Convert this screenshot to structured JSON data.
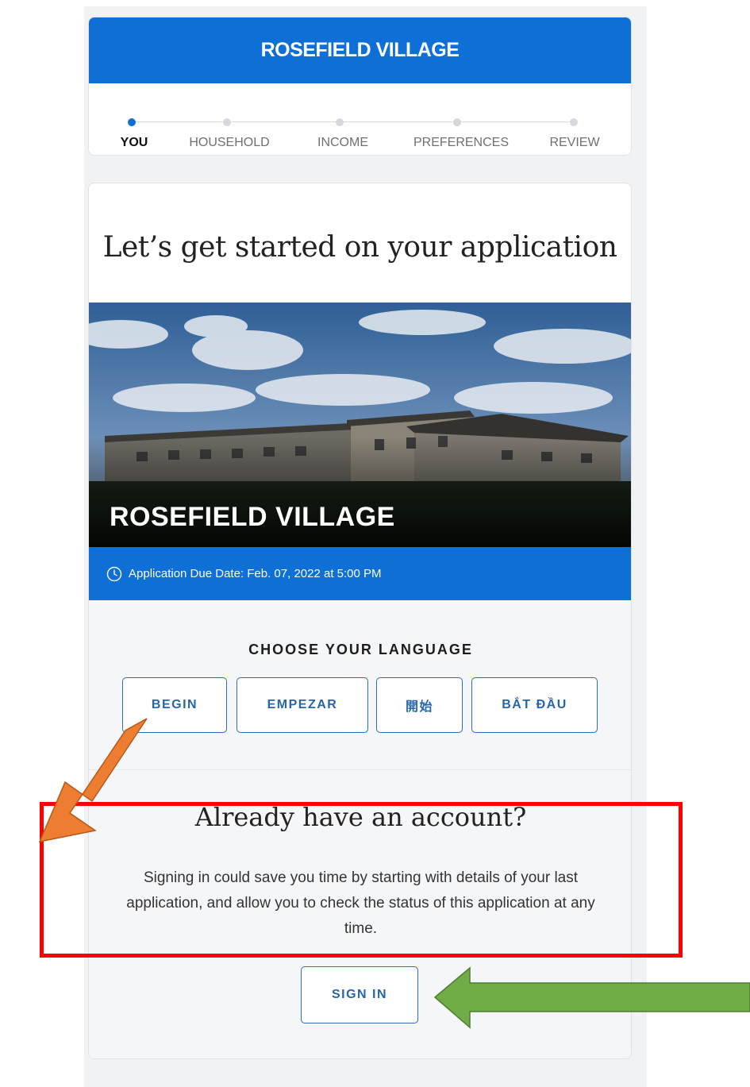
{
  "header": {
    "title": "ROSEFIELD VILLAGE"
  },
  "steps": [
    {
      "label": "YOU",
      "active": true
    },
    {
      "label": "HOUSEHOLD",
      "active": false
    },
    {
      "label": "INCOME",
      "active": false
    },
    {
      "label": "PREFERENCES",
      "active": false
    },
    {
      "label": "REVIEW",
      "active": false
    }
  ],
  "main": {
    "title": "Let’s get started on your application",
    "hero_name": "ROSEFIELD VILLAGE",
    "due_date": "Application Due Date: Feb. 07, 2022 at 5:00 PM"
  },
  "language": {
    "heading": "CHOOSE YOUR LANGUAGE",
    "buttons": [
      "BEGIN",
      "EMPEZAR",
      "開始",
      "BẮT ĐẦU"
    ]
  },
  "account": {
    "title": "Already have an account?",
    "description": "Signing in could save you time by starting with details of your last application, and allow you to check the status of this application at any time.",
    "signin_label": "SIGN IN"
  },
  "colors": {
    "primary": "#0e6fd6",
    "button_text": "#2766aa",
    "annotation_red": "#ff0000",
    "annotation_orange": "#ed7d31",
    "annotation_green": "#70ad47"
  }
}
